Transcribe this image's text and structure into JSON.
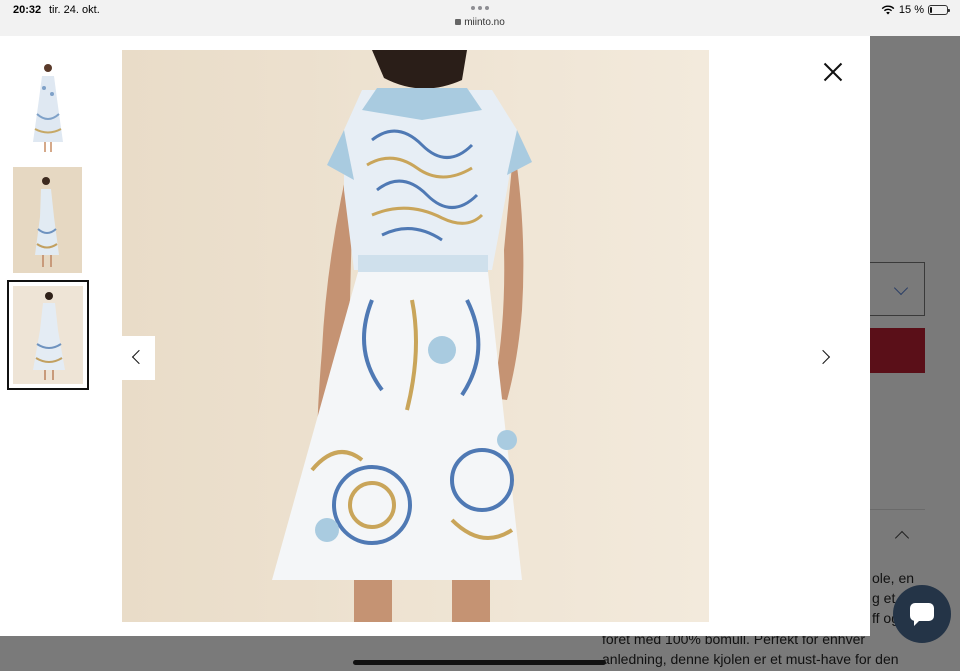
{
  "status_bar": {
    "time": "20:32",
    "date": "tir. 24. okt.",
    "url": "miinto.no",
    "battery": "15 %",
    "battery_level": 0.15
  },
  "modal": {
    "thumbnails": [
      {
        "description": "dress-front-full"
      },
      {
        "description": "dress-side-full"
      },
      {
        "description": "dress-back-full",
        "selected": true
      }
    ],
    "selected_index": 2
  },
  "background_page": {
    "description_lines": [
      {
        "left": "",
        "right": "ole, en"
      },
      {
        "left": "",
        "right": "g et"
      },
      {
        "left": "",
        "right": "ff og"
      },
      {
        "left": "foret med 100% bomull. Perfekt for enhver",
        "right": ""
      },
      {
        "left": "anledning, denne kjolen er et must-have for den",
        "right": ""
      }
    ]
  },
  "colors": {
    "accent_dark_red": "#5a0f18",
    "chat_button": "#243447",
    "chevron_blue": "#2c3f66"
  },
  "icons": {
    "close": "close-icon",
    "prev": "chevron-left-icon",
    "next": "chevron-right-icon",
    "chat": "chat-bubble-icon",
    "wifi": "wifi-icon",
    "battery": "battery-icon",
    "lock": "lock-icon"
  }
}
